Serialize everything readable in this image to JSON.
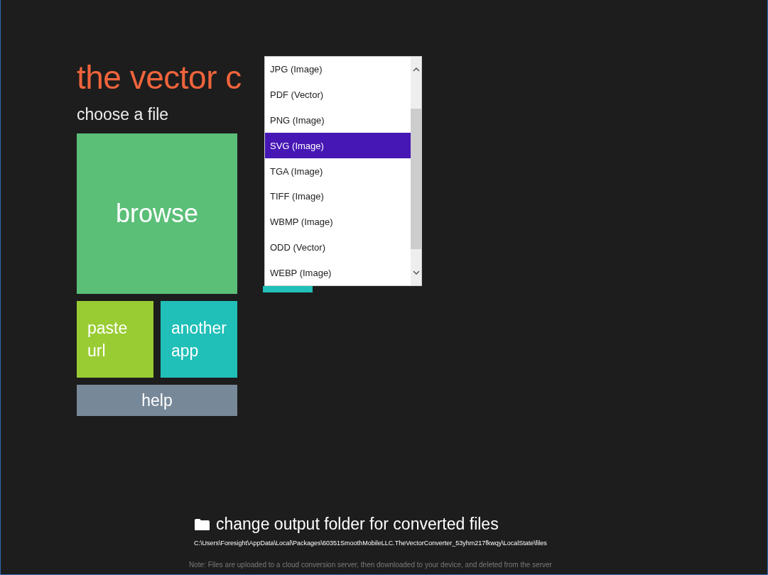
{
  "app_title": "the vector c",
  "section_heading": "choose a file",
  "tiles": [
    {
      "kind": "large",
      "label": "browse",
      "color": "#5bbf78"
    },
    {
      "kind": "small",
      "label": "paste\nurl",
      "color": "#99cc33"
    },
    {
      "kind": "small",
      "label": "another\napp",
      "color": "#20bfb8"
    },
    {
      "kind": "wide",
      "label": "help",
      "color": "#778899"
    }
  ],
  "format_dropdown": {
    "items": [
      {
        "label": "JPG (Image)",
        "selected": false
      },
      {
        "label": "PDF (Vector)",
        "selected": false
      },
      {
        "label": "PNG (Image)",
        "selected": false
      },
      {
        "label": "SVG (Image)",
        "selected": true
      },
      {
        "label": "TGA (Image)",
        "selected": false
      },
      {
        "label": "TIFF (Image)",
        "selected": false
      },
      {
        "label": "WBMP (Image)",
        "selected": false
      },
      {
        "label": "ODD (Vector)",
        "selected": false
      },
      {
        "label": "WEBP (Image)",
        "selected": false
      }
    ]
  },
  "output_folder": {
    "label": "change output folder for converted files",
    "path": "C:\\Users\\Foresight\\AppData\\Local\\Packages\\60351SmoothMobileLLC.TheVectorConverter_53yhm217fkwqy\\LocalState\\files"
  },
  "note": "Note: Files are uploaded to a cloud conversion server, then downloaded to your device, and deleted from the server"
}
